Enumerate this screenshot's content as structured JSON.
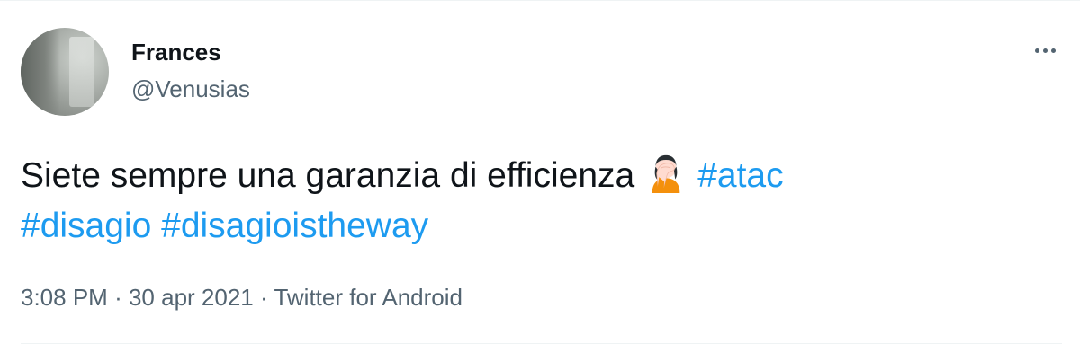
{
  "author": {
    "name": "Frances",
    "handle": "@Venusias"
  },
  "more_icon": "more-horizontal-icon",
  "tweet": {
    "text_before": "Siete sempre una garanzia di efficienza",
    "emoji": "woman-facepalming-icon",
    "hashtags": [
      "#atac",
      "#disagio",
      "#disagioistheway"
    ]
  },
  "meta": {
    "time": "3:08 PM",
    "separator": "·",
    "date": "30 apr 2021",
    "source": "Twitter for Android"
  },
  "colors": {
    "text": "#0f1419",
    "secondary": "#536471",
    "link": "#1d9bf0",
    "divider": "#eff3f4"
  }
}
